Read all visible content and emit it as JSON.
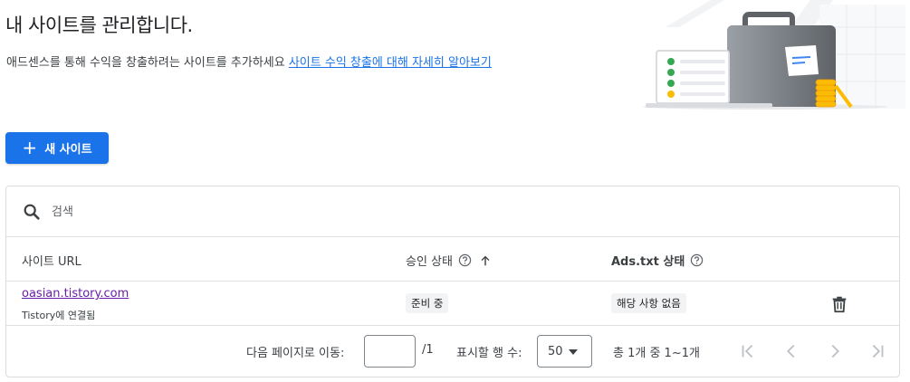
{
  "header": {
    "title": "내 사이트를 관리합니다.",
    "subtitle": "애드센스를 통해 수익을 창출하려는 사이트를 추가하세요",
    "learn_more_link": "사이트 수익 창출에 대해 자세히 알아보기"
  },
  "actions": {
    "new_site_label": "새 사이트"
  },
  "search": {
    "placeholder": "검색"
  },
  "table": {
    "columns": {
      "site_url": "사이트 URL",
      "approval_status": "승인 상태",
      "ads_txt_status": "Ads.txt 상태"
    },
    "rows": [
      {
        "site_url": "oasian.tistory.com",
        "connected_to": "Tistory에 연결됨",
        "approval_status": "준비 중",
        "ads_txt_status": "해당 사항 없음"
      }
    ]
  },
  "pagination": {
    "goto_label": "다음 페이지로 이동:",
    "goto_value": "",
    "total_pages": "/1",
    "rows_per_page_label": "표시할 행 수:",
    "rows_per_page_value": "50",
    "range_text": "총 1개 중 1~1개"
  },
  "colors": {
    "primary": "#1a73e8",
    "visited_link": "#681da8",
    "border": "#dadce0",
    "chip_bg": "#f1f3f4"
  },
  "icons": {
    "search": "search-icon",
    "help": "help-circle-icon",
    "sort": "arrow-up-icon",
    "delete": "trash-icon",
    "first_page": "first-page-icon",
    "prev_page": "chevron-left-icon",
    "next_page": "chevron-right-icon",
    "last_page": "last-page-icon"
  }
}
